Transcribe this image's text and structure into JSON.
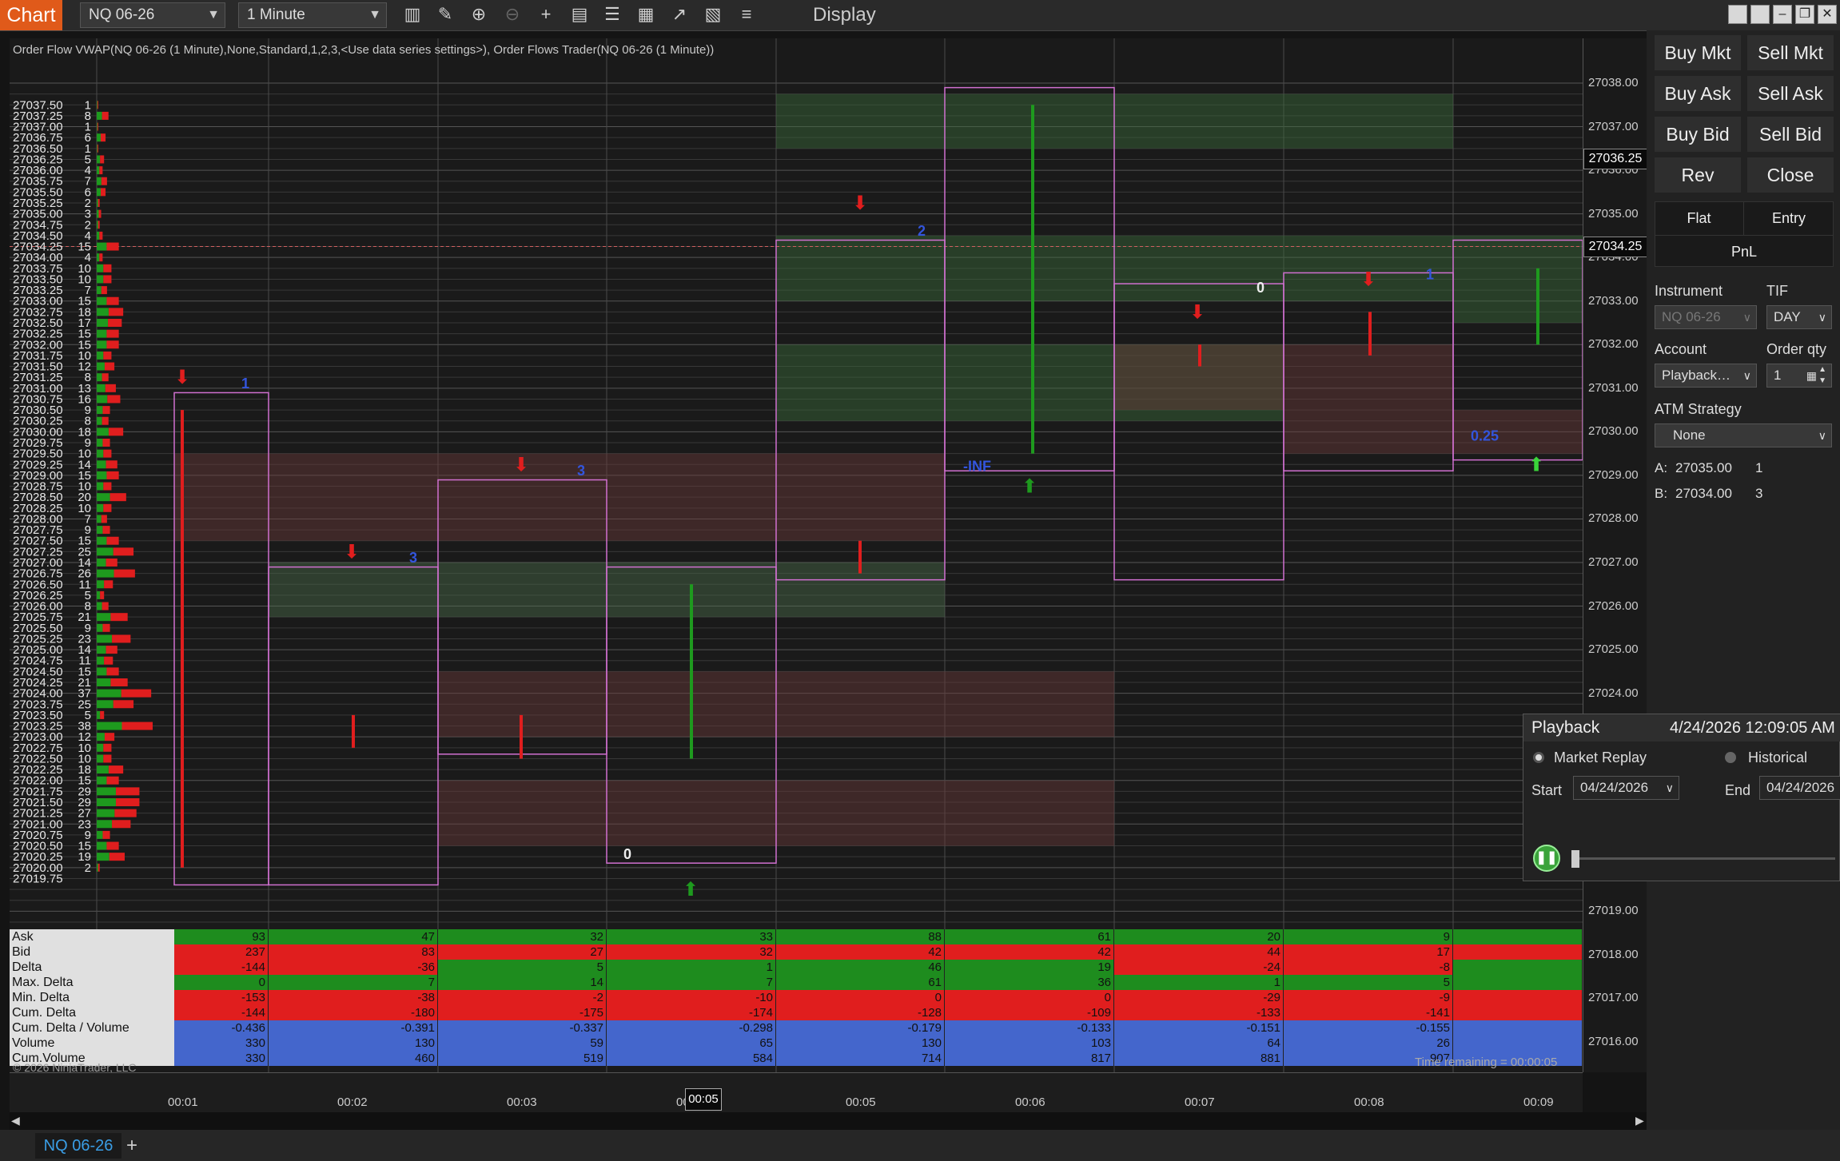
{
  "toolbar": {
    "chart_tab": "Chart",
    "instrument": "NQ 06-26",
    "interval": "1 Minute",
    "display": "Display",
    "icons": [
      "bar-type-icon",
      "drawing-tool-icon",
      "zoom-in-icon",
      "zoom-out-icon",
      "crosshair-icon",
      "data-box-icon",
      "properties-icon",
      "indicators-icon",
      "strategies-icon",
      "templates-icon",
      "object-list-icon"
    ]
  },
  "chart": {
    "indicator_label": "Order Flow VWAP(NQ 06-26 (1 Minute),None,Standard,1,2,3,<Use data series settings>), Order Flows Trader(NQ 06-26 (1 Minute))",
    "price_ticks": [
      "27038.00",
      "27037.00",
      "27036.00",
      "27035.00",
      "27034.00",
      "27033.00",
      "27032.00",
      "27031.00",
      "27030.00",
      "27029.00",
      "27028.00",
      "27027.00",
      "27026.00",
      "27025.00",
      "27024.00",
      "27023.00",
      "27022.00",
      "27021.00",
      "27020.00",
      "27019.00",
      "27018.00",
      "27017.00",
      "27016.00"
    ],
    "last_price_flag": "27036.25",
    "current_price_flag": "27034.25",
    "time_ticks": [
      "00:01",
      "00:02",
      "00:03",
      "00:04",
      "00:05",
      "00:06",
      "00:07",
      "00:08",
      "00:09"
    ],
    "time_flag": "00:05",
    "copyright": "© 2026 NinjaTrader, LLC",
    "time_remaining": "Time remaining = 00:00:05",
    "annotations": {
      "inf": "-INF",
      "zero_1": "0",
      "zero_2": "0",
      "val_025": "0.25",
      "blue_1": "1",
      "blue_3a": "3",
      "blue_3b": "3",
      "blue_2": "2",
      "blue_1b": "1"
    }
  },
  "volume_profile": {
    "prices": [
      "27037.50",
      "27037.25",
      "27037.00",
      "27036.75",
      "27036.50",
      "27036.25",
      "27036.00",
      "27035.75",
      "27035.50",
      "27035.25",
      "27035.00",
      "27034.75",
      "27034.50",
      "27034.25",
      "27034.00",
      "27033.75",
      "27033.50",
      "27033.25",
      "27033.00",
      "27032.75",
      "27032.50",
      "27032.25",
      "27032.00",
      "27031.75",
      "27031.50",
      "27031.25",
      "27031.00",
      "27030.75",
      "27030.50",
      "27030.25",
      "27030.00",
      "27029.75",
      "27029.50",
      "27029.25",
      "27029.00",
      "27028.75",
      "27028.50",
      "27028.25",
      "27028.00",
      "27027.75",
      "27027.50",
      "27027.25",
      "27027.00",
      "27026.75",
      "27026.50",
      "27026.25",
      "27026.00",
      "27025.75",
      "27025.50",
      "27025.25",
      "27025.00",
      "27024.75",
      "27024.50",
      "27024.25",
      "27024.00",
      "27023.75",
      "27023.50",
      "27023.25",
      "27023.00",
      "27022.75",
      "27022.50",
      "27022.25",
      "27022.00",
      "27021.75",
      "27021.50",
      "27021.25",
      "27021.00",
      "27020.75",
      "27020.50",
      "27020.25",
      "27020.00",
      "27019.75"
    ],
    "volumes": [
      "1",
      "8",
      "1",
      "6",
      "1",
      "5",
      "4",
      "7",
      "6",
      "2",
      "3",
      "2",
      "4",
      "15",
      "4",
      "10",
      "10",
      "7",
      "15",
      "18",
      "17",
      "15",
      "15",
      "10",
      "12",
      "8",
      "13",
      "16",
      "9",
      "8",
      "18",
      "9",
      "10",
      "14",
      "15",
      "10",
      "20",
      "10",
      "7",
      "9",
      "15",
      "25",
      "14",
      "26",
      "11",
      "5",
      "8",
      "21",
      "9",
      "23",
      "14",
      "11",
      "15",
      "21",
      "37",
      "25",
      "5",
      "38",
      "12",
      "10",
      "10",
      "18",
      "15",
      "29",
      "29",
      "27",
      "23",
      "9",
      "15",
      "19",
      "2"
    ]
  },
  "stats": {
    "rows": [
      {
        "name": "Ask",
        "values": [
          "93",
          "47",
          "32",
          "33",
          "88",
          "61",
          "20",
          "9",
          ""
        ]
      },
      {
        "name": "Bid",
        "values": [
          "237",
          "83",
          "27",
          "32",
          "42",
          "42",
          "44",
          "17",
          ""
        ]
      },
      {
        "name": "Delta",
        "values": [
          "-144",
          "-36",
          "5",
          "1",
          "46",
          "19",
          "-24",
          "-8",
          ""
        ]
      },
      {
        "name": "Max. Delta",
        "values": [
          "0",
          "7",
          "14",
          "7",
          "61",
          "36",
          "1",
          "5",
          ""
        ]
      },
      {
        "name": "Min. Delta",
        "values": [
          "-153",
          "-38",
          "-2",
          "-10",
          "0",
          "0",
          "-29",
          "-9",
          ""
        ]
      },
      {
        "name": "Cum. Delta",
        "values": [
          "-144",
          "-180",
          "-175",
          "-174",
          "-128",
          "-109",
          "-133",
          "-141",
          ""
        ]
      },
      {
        "name": "Cum. Delta / Volume",
        "values": [
          "-0.436",
          "-0.391",
          "-0.337",
          "-0.298",
          "-0.179",
          "-0.133",
          "-0.151",
          "-0.155",
          ""
        ]
      },
      {
        "name": "Volume",
        "values": [
          "330",
          "130",
          "59",
          "65",
          "130",
          "103",
          "64",
          "26",
          ""
        ]
      },
      {
        "name": "Cum.Volume",
        "values": [
          "330",
          "460",
          "519",
          "584",
          "714",
          "817",
          "881",
          "907",
          ""
        ]
      }
    ]
  },
  "order_panel": {
    "buy_mkt": "Buy Mkt",
    "sell_mkt": "Sell Mkt",
    "buy_ask": "Buy Ask",
    "sell_ask": "Sell Ask",
    "buy_bid": "Buy Bid",
    "sell_bid": "Sell Bid",
    "rev": "Rev",
    "close": "Close",
    "flat": "Flat",
    "entry": "Entry",
    "pnl": "PnL",
    "instrument_label": "Instrument",
    "instrument_value": "NQ 06-26",
    "tif_label": "TIF",
    "tif_value": "DAY",
    "account_label": "Account",
    "account_value": "Playback…",
    "order_qty_label": "Order qty",
    "order_qty_value": "1",
    "atm_label": "ATM Strategy",
    "atm_value": "None",
    "ask_label": "A:",
    "ask_price": "27035.00",
    "ask_qty": "1",
    "bid_label": "B:",
    "bid_price": "27034.00",
    "bid_qty": "3"
  },
  "playback": {
    "title": "Playback",
    "datetime": "4/24/2026 12:09:05 AM",
    "market_replay": "Market Replay",
    "historical": "Historical",
    "start_label": "Start",
    "start_value": "04/24/2026",
    "end_label": "End",
    "end_value": "04/24/2026"
  },
  "bottom": {
    "tab": "NQ 06-26",
    "add": "+"
  },
  "colors": {
    "accent": "#e05a1a",
    "ask_green": "#1e8c1e",
    "bid_red": "#e01e1e",
    "blue": "#3355dd",
    "box_outline": "#d070d0"
  }
}
